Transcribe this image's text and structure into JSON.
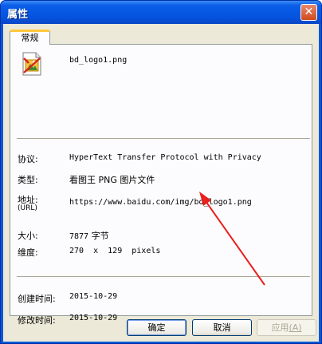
{
  "window": {
    "title": "属性",
    "close_glyph": "✕"
  },
  "tab": {
    "label": "常规"
  },
  "file": {
    "name": "bd_logo1.png",
    "icon": "picture-file-icon"
  },
  "fields": {
    "protocol_label": "协议:",
    "protocol_value": "HyperText Transfer Protocol with Privacy",
    "type_label": "类型:",
    "type_value": "看图王 PNG 图片文件",
    "address_label": "地址:",
    "address_sublabel": "(URL)",
    "address_value": "https://www.baidu.com/img/bd_logo1.png",
    "size_label": "大小:",
    "size_number": "7877",
    "size_unit": "字节",
    "dimension_label": "维度:",
    "dimension_value": "270  x  129  pixels"
  },
  "dates": {
    "created_label": "创建时间:",
    "created_value": "2015-10-29",
    "modified_label": "修改时间:",
    "modified_value": "2015-10-29"
  },
  "buttons": {
    "ok": "确定",
    "cancel": "取消",
    "apply": "应用",
    "apply_accel": "(A)"
  },
  "colors": {
    "title_bar": "#0a5ee8",
    "dialog_bg": "#ece9d8",
    "tab_accent": "#ffc73c",
    "annotation_arrow": "#e8201e"
  }
}
